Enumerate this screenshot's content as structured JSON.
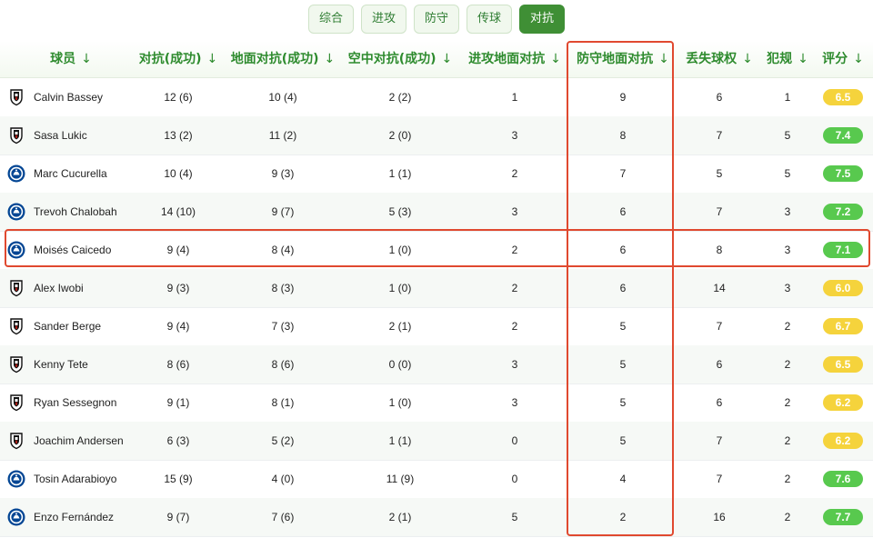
{
  "tabs": [
    "综合",
    "进攻",
    "防守",
    "传球",
    "对抗"
  ],
  "active_tab": 4,
  "columns": [
    "球员",
    "对抗(成功)",
    "地面对抗(成功)",
    "空中对抗(成功)",
    "进攻地面对抗",
    "防守地面对抗",
    "丢失球权",
    "犯规",
    "评分"
  ],
  "sort_arrow": "↓",
  "highlighted_column": "防守地面对抗",
  "highlighted_player": "Moisés Caicedo",
  "colors": {
    "green_text": "#2e8b2e",
    "highlight": "#e0492f",
    "rating_yellow": "#f5d33c",
    "rating_green": "#58c94e"
  },
  "rows": [
    {
      "player": "Calvin Bassey",
      "team": "fulham",
      "duels": "12 (6)",
      "ground": "10 (4)",
      "aerial": "2 (2)",
      "att_ground": "1",
      "def_ground": "9",
      "lost": "6",
      "fouls": "1",
      "rating": "6.5"
    },
    {
      "player": "Sasa Lukic",
      "team": "fulham",
      "duels": "13 (2)",
      "ground": "11 (2)",
      "aerial": "2 (0)",
      "att_ground": "3",
      "def_ground": "8",
      "lost": "7",
      "fouls": "5",
      "rating": "7.4"
    },
    {
      "player": "Marc Cucurella",
      "team": "chelsea",
      "duels": "10 (4)",
      "ground": "9 (3)",
      "aerial": "1 (1)",
      "att_ground": "2",
      "def_ground": "7",
      "lost": "5",
      "fouls": "5",
      "rating": "7.5"
    },
    {
      "player": "Trevoh Chalobah",
      "team": "chelsea",
      "duels": "14 (10)",
      "ground": "9 (7)",
      "aerial": "5 (3)",
      "att_ground": "3",
      "def_ground": "6",
      "lost": "7",
      "fouls": "3",
      "rating": "7.2"
    },
    {
      "player": "Moisés Caicedo",
      "team": "chelsea",
      "duels": "9 (4)",
      "ground": "8 (4)",
      "aerial": "1 (0)",
      "att_ground": "2",
      "def_ground": "6",
      "lost": "8",
      "fouls": "3",
      "rating": "7.1"
    },
    {
      "player": "Alex Iwobi",
      "team": "fulham",
      "duels": "9 (3)",
      "ground": "8 (3)",
      "aerial": "1 (0)",
      "att_ground": "2",
      "def_ground": "6",
      "lost": "14",
      "fouls": "3",
      "rating": "6.0"
    },
    {
      "player": "Sander Berge",
      "team": "fulham",
      "duels": "9 (4)",
      "ground": "7 (3)",
      "aerial": "2 (1)",
      "att_ground": "2",
      "def_ground": "5",
      "lost": "7",
      "fouls": "2",
      "rating": "6.7"
    },
    {
      "player": "Kenny Tete",
      "team": "fulham",
      "duels": "8 (6)",
      "ground": "8 (6)",
      "aerial": "0 (0)",
      "att_ground": "3",
      "def_ground": "5",
      "lost": "6",
      "fouls": "2",
      "rating": "6.5"
    },
    {
      "player": "Ryan Sessegnon",
      "team": "fulham",
      "duels": "9 (1)",
      "ground": "8 (1)",
      "aerial": "1 (0)",
      "att_ground": "3",
      "def_ground": "5",
      "lost": "6",
      "fouls": "2",
      "rating": "6.2"
    },
    {
      "player": "Joachim Andersen",
      "team": "fulham",
      "duels": "6 (3)",
      "ground": "5 (2)",
      "aerial": "1 (1)",
      "att_ground": "0",
      "def_ground": "5",
      "lost": "7",
      "fouls": "2",
      "rating": "6.2"
    },
    {
      "player": "Tosin Adarabioyo",
      "team": "chelsea",
      "duels": "15 (9)",
      "ground": "4 (0)",
      "aerial": "11 (9)",
      "att_ground": "0",
      "def_ground": "4",
      "lost": "7",
      "fouls": "2",
      "rating": "7.6"
    },
    {
      "player": "Enzo Fernández",
      "team": "chelsea",
      "duels": "9 (7)",
      "ground": "7 (6)",
      "aerial": "2 (1)",
      "att_ground": "5",
      "def_ground": "2",
      "lost": "16",
      "fouls": "2",
      "rating": "7.7"
    }
  ]
}
